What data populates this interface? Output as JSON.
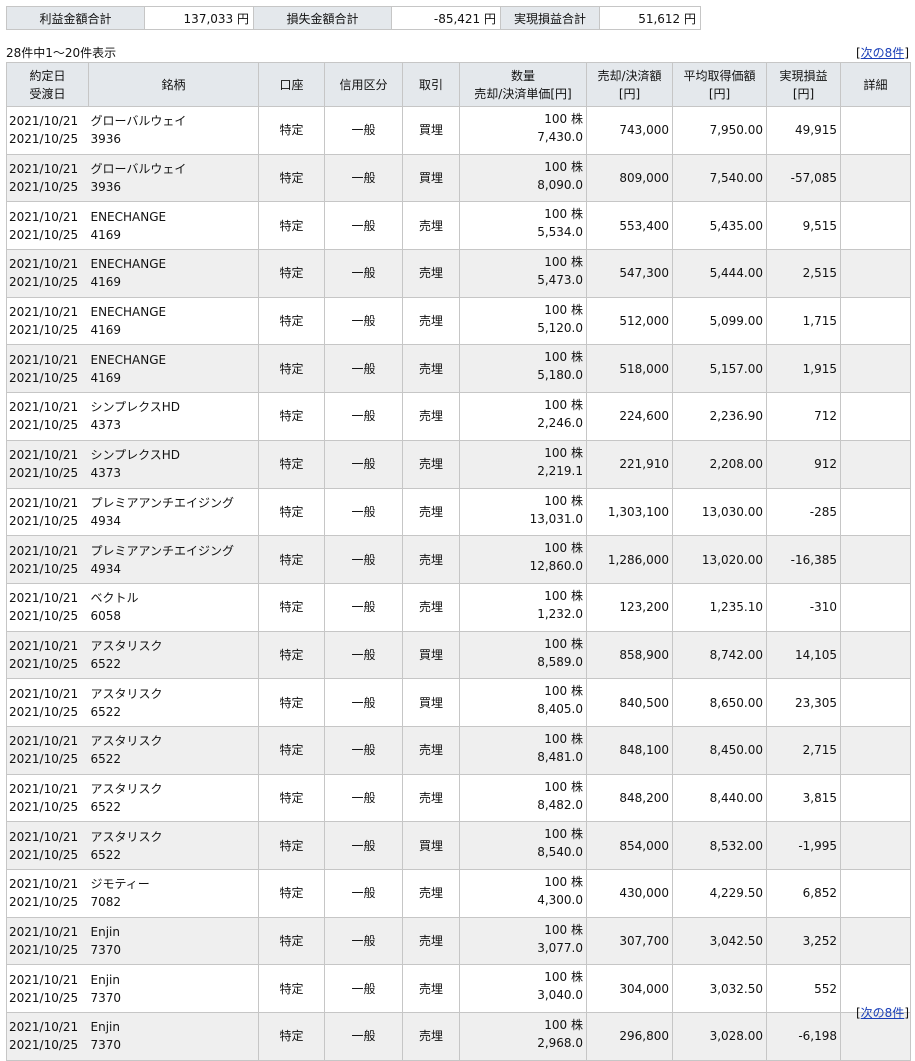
{
  "summary": {
    "profit_label": "利益金額合計",
    "profit_value": "137,033 円",
    "loss_label": "損失金額合計",
    "loss_value": "-85,421 円",
    "realized_label": "実現損益合計",
    "realized_value": "51,612 円"
  },
  "count_text": "28件中1～20件表示",
  "pager": {
    "prefix": "[",
    "next_label": "次の8件",
    "suffix": "]"
  },
  "columns": {
    "date_line1": "約定日",
    "date_line2": "受渡日",
    "name": "銘柄",
    "account": "口座",
    "credit": "信用区分",
    "trade": "取引",
    "qty_line1": "数量",
    "qty_line2": "売却/決済単価[円]",
    "sale_line1": "売却/決済額",
    "sale_line2": "[円]",
    "avg_line1": "平均取得価額",
    "avg_line2": "[円]",
    "pl_line1": "実現損益",
    "pl_line2": "[円]",
    "detail": "詳細"
  },
  "rows": [
    {
      "trade_date": "2021/10/21",
      "settle_date": "2021/10/25",
      "name": "グローバルウェイ",
      "code": "3936",
      "account": "特定",
      "credit": "一般",
      "trade": "買埋",
      "qty": "100 株",
      "unit_price": "7,430.0",
      "sale_amount": "743,000",
      "avg_price": "7,950.00",
      "pl": "49,915"
    },
    {
      "trade_date": "2021/10/21",
      "settle_date": "2021/10/25",
      "name": "グローバルウェイ",
      "code": "3936",
      "account": "特定",
      "credit": "一般",
      "trade": "買埋",
      "qty": "100 株",
      "unit_price": "8,090.0",
      "sale_amount": "809,000",
      "avg_price": "7,540.00",
      "pl": "-57,085"
    },
    {
      "trade_date": "2021/10/21",
      "settle_date": "2021/10/25",
      "name": "ENECHANGE",
      "code": "4169",
      "account": "特定",
      "credit": "一般",
      "trade": "売埋",
      "qty": "100 株",
      "unit_price": "5,534.0",
      "sale_amount": "553,400",
      "avg_price": "5,435.00",
      "pl": "9,515"
    },
    {
      "trade_date": "2021/10/21",
      "settle_date": "2021/10/25",
      "name": "ENECHANGE",
      "code": "4169",
      "account": "特定",
      "credit": "一般",
      "trade": "売埋",
      "qty": "100 株",
      "unit_price": "5,473.0",
      "sale_amount": "547,300",
      "avg_price": "5,444.00",
      "pl": "2,515"
    },
    {
      "trade_date": "2021/10/21",
      "settle_date": "2021/10/25",
      "name": "ENECHANGE",
      "code": "4169",
      "account": "特定",
      "credit": "一般",
      "trade": "売埋",
      "qty": "100 株",
      "unit_price": "5,120.0",
      "sale_amount": "512,000",
      "avg_price": "5,099.00",
      "pl": "1,715"
    },
    {
      "trade_date": "2021/10/21",
      "settle_date": "2021/10/25",
      "name": "ENECHANGE",
      "code": "4169",
      "account": "特定",
      "credit": "一般",
      "trade": "売埋",
      "qty": "100 株",
      "unit_price": "5,180.0",
      "sale_amount": "518,000",
      "avg_price": "5,157.00",
      "pl": "1,915"
    },
    {
      "trade_date": "2021/10/21",
      "settle_date": "2021/10/25",
      "name": "シンプレクスHD",
      "code": "4373",
      "account": "特定",
      "credit": "一般",
      "trade": "売埋",
      "qty": "100 株",
      "unit_price": "2,246.0",
      "sale_amount": "224,600",
      "avg_price": "2,236.90",
      "pl": "712"
    },
    {
      "trade_date": "2021/10/21",
      "settle_date": "2021/10/25",
      "name": "シンプレクスHD",
      "code": "4373",
      "account": "特定",
      "credit": "一般",
      "trade": "売埋",
      "qty": "100 株",
      "unit_price": "2,219.1",
      "sale_amount": "221,910",
      "avg_price": "2,208.00",
      "pl": "912"
    },
    {
      "trade_date": "2021/10/21",
      "settle_date": "2021/10/25",
      "name": "プレミアアンチエイジング",
      "code": "4934",
      "account": "特定",
      "credit": "一般",
      "trade": "売埋",
      "qty": "100 株",
      "unit_price": "13,031.0",
      "sale_amount": "1,303,100",
      "avg_price": "13,030.00",
      "pl": "-285"
    },
    {
      "trade_date": "2021/10/21",
      "settle_date": "2021/10/25",
      "name": "プレミアアンチエイジング",
      "code": "4934",
      "account": "特定",
      "credit": "一般",
      "trade": "売埋",
      "qty": "100 株",
      "unit_price": "12,860.0",
      "sale_amount": "1,286,000",
      "avg_price": "13,020.00",
      "pl": "-16,385"
    },
    {
      "trade_date": "2021/10/21",
      "settle_date": "2021/10/25",
      "name": "ベクトル",
      "code": "6058",
      "account": "特定",
      "credit": "一般",
      "trade": "売埋",
      "qty": "100 株",
      "unit_price": "1,232.0",
      "sale_amount": "123,200",
      "avg_price": "1,235.10",
      "pl": "-310"
    },
    {
      "trade_date": "2021/10/21",
      "settle_date": "2021/10/25",
      "name": "アスタリスク",
      "code": "6522",
      "account": "特定",
      "credit": "一般",
      "trade": "買埋",
      "qty": "100 株",
      "unit_price": "8,589.0",
      "sale_amount": "858,900",
      "avg_price": "8,742.00",
      "pl": "14,105"
    },
    {
      "trade_date": "2021/10/21",
      "settle_date": "2021/10/25",
      "name": "アスタリスク",
      "code": "6522",
      "account": "特定",
      "credit": "一般",
      "trade": "買埋",
      "qty": "100 株",
      "unit_price": "8,405.0",
      "sale_amount": "840,500",
      "avg_price": "8,650.00",
      "pl": "23,305"
    },
    {
      "trade_date": "2021/10/21",
      "settle_date": "2021/10/25",
      "name": "アスタリスク",
      "code": "6522",
      "account": "特定",
      "credit": "一般",
      "trade": "売埋",
      "qty": "100 株",
      "unit_price": "8,481.0",
      "sale_amount": "848,100",
      "avg_price": "8,450.00",
      "pl": "2,715"
    },
    {
      "trade_date": "2021/10/21",
      "settle_date": "2021/10/25",
      "name": "アスタリスク",
      "code": "6522",
      "account": "特定",
      "credit": "一般",
      "trade": "売埋",
      "qty": "100 株",
      "unit_price": "8,482.0",
      "sale_amount": "848,200",
      "avg_price": "8,440.00",
      "pl": "3,815"
    },
    {
      "trade_date": "2021/10/21",
      "settle_date": "2021/10/25",
      "name": "アスタリスク",
      "code": "6522",
      "account": "特定",
      "credit": "一般",
      "trade": "買埋",
      "qty": "100 株",
      "unit_price": "8,540.0",
      "sale_amount": "854,000",
      "avg_price": "8,532.00",
      "pl": "-1,995"
    },
    {
      "trade_date": "2021/10/21",
      "settle_date": "2021/10/25",
      "name": "ジモティー",
      "code": "7082",
      "account": "特定",
      "credit": "一般",
      "trade": "売埋",
      "qty": "100 株",
      "unit_price": "4,300.0",
      "sale_amount": "430,000",
      "avg_price": "4,229.50",
      "pl": "6,852"
    },
    {
      "trade_date": "2021/10/21",
      "settle_date": "2021/10/25",
      "name": "Enjin",
      "code": "7370",
      "account": "特定",
      "credit": "一般",
      "trade": "売埋",
      "qty": "100 株",
      "unit_price": "3,077.0",
      "sale_amount": "307,700",
      "avg_price": "3,042.50",
      "pl": "3,252"
    },
    {
      "trade_date": "2021/10/21",
      "settle_date": "2021/10/25",
      "name": "Enjin",
      "code": "7370",
      "account": "特定",
      "credit": "一般",
      "trade": "売埋",
      "qty": "100 株",
      "unit_price": "3,040.0",
      "sale_amount": "304,000",
      "avg_price": "3,032.50",
      "pl": "552"
    },
    {
      "trade_date": "2021/10/21",
      "settle_date": "2021/10/25",
      "name": "Enjin",
      "code": "7370",
      "account": "特定",
      "credit": "一般",
      "trade": "売埋",
      "qty": "100 株",
      "unit_price": "2,968.0",
      "sale_amount": "296,800",
      "avg_price": "3,028.00",
      "pl": "-6,198"
    }
  ]
}
